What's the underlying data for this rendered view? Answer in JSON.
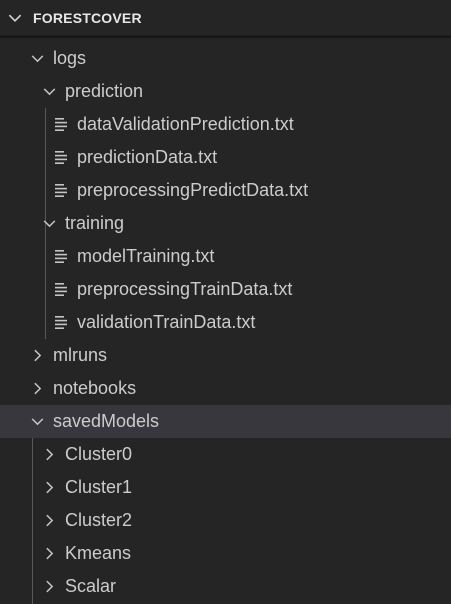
{
  "explorer": {
    "section_title": "FORESTCOVER",
    "tree": [
      {
        "label": "logs",
        "type": "folder",
        "expanded": true,
        "icon": "chevron-down-icon"
      },
      {
        "label": "prediction",
        "type": "folder",
        "expanded": true,
        "icon": "chevron-down-icon"
      },
      {
        "label": "dataValidationPrediction.txt",
        "type": "file",
        "icon": "text-file-icon"
      },
      {
        "label": "predictionData.txt",
        "type": "file",
        "icon": "text-file-icon"
      },
      {
        "label": "preprocessingPredictData.txt",
        "type": "file",
        "icon": "text-file-icon"
      },
      {
        "label": "training",
        "type": "folder",
        "expanded": true,
        "icon": "chevron-down-icon"
      },
      {
        "label": "modelTraining.txt",
        "type": "file",
        "icon": "text-file-icon"
      },
      {
        "label": "preprocessingTrainData.txt",
        "type": "file",
        "icon": "text-file-icon"
      },
      {
        "label": "validationTrainData.txt",
        "type": "file",
        "icon": "text-file-icon"
      },
      {
        "label": "mlruns",
        "type": "folder",
        "expanded": false,
        "icon": "chevron-right-icon"
      },
      {
        "label": "notebooks",
        "type": "folder",
        "expanded": false,
        "icon": "chevron-right-icon"
      },
      {
        "label": "savedModels",
        "type": "folder",
        "expanded": true,
        "selected": true,
        "icon": "chevron-down-icon"
      },
      {
        "label": "Cluster0",
        "type": "folder",
        "expanded": false,
        "icon": "chevron-right-icon"
      },
      {
        "label": "Cluster1",
        "type": "folder",
        "expanded": false,
        "icon": "chevron-right-icon"
      },
      {
        "label": "Cluster2",
        "type": "folder",
        "expanded": false,
        "icon": "chevron-right-icon"
      },
      {
        "label": "Kmeans",
        "type": "folder",
        "expanded": false,
        "icon": "chevron-right-icon"
      },
      {
        "label": "Scalar",
        "type": "folder",
        "expanded": false,
        "icon": "chevron-right-icon"
      }
    ]
  },
  "colors": {
    "background": "#252526",
    "text": "#cccccc",
    "selected_row": "#37373d",
    "indent_guide": "#585858"
  }
}
